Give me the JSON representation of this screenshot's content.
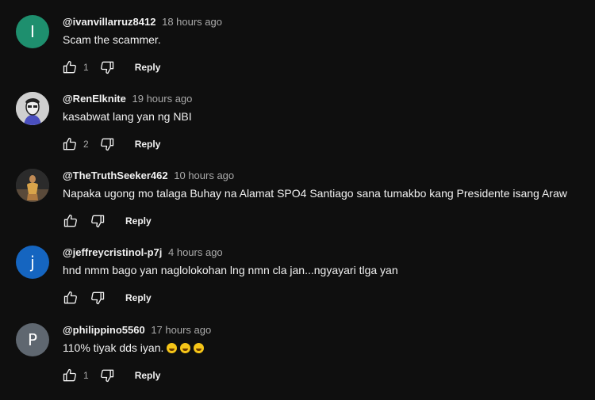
{
  "comments": [
    {
      "handle": "@ivanvillarruz8412",
      "time": "18 hours ago",
      "text": "Scam the scammer.",
      "likes": "1",
      "reply": "Reply",
      "avatar": {
        "type": "letter",
        "letter": "I",
        "color": "#1e8f6e"
      }
    },
    {
      "handle": "@RenElknite",
      "time": "19 hours ago",
      "text": "kasabwat lang yan ng NBI",
      "likes": "2",
      "reply": "Reply",
      "avatar": {
        "type": "image",
        "color": "#c9c9c9"
      }
    },
    {
      "handle": "@TheTruthSeeker462",
      "time": "10 hours ago",
      "text": "Napaka ugong mo talaga Buhay na Alamat SPO4 Santiago sana tumakbo kang Presidente isang Araw",
      "likes": "",
      "reply": "Reply",
      "avatar": {
        "type": "image",
        "color": "#3a3a3a"
      }
    },
    {
      "handle": "@jeffreycristinol-p7j",
      "time": "4 hours ago",
      "text": "hnd nmm bago yan naglolokohan lng nmn cla jan...ngyayari tlga yan",
      "likes": "",
      "reply": "Reply",
      "avatar": {
        "type": "letter",
        "letter": "j",
        "color": "#1565c0"
      }
    },
    {
      "handle": "@philippino5560",
      "time": "17 hours ago",
      "text": "110% tiyak dds iyan.",
      "emoji_count": 3,
      "emoji_name": "grinning-squinting-face",
      "likes": "1",
      "reply": "Reply",
      "avatar": {
        "type": "letter",
        "letter": "P",
        "color": "#5f6770"
      }
    }
  ]
}
